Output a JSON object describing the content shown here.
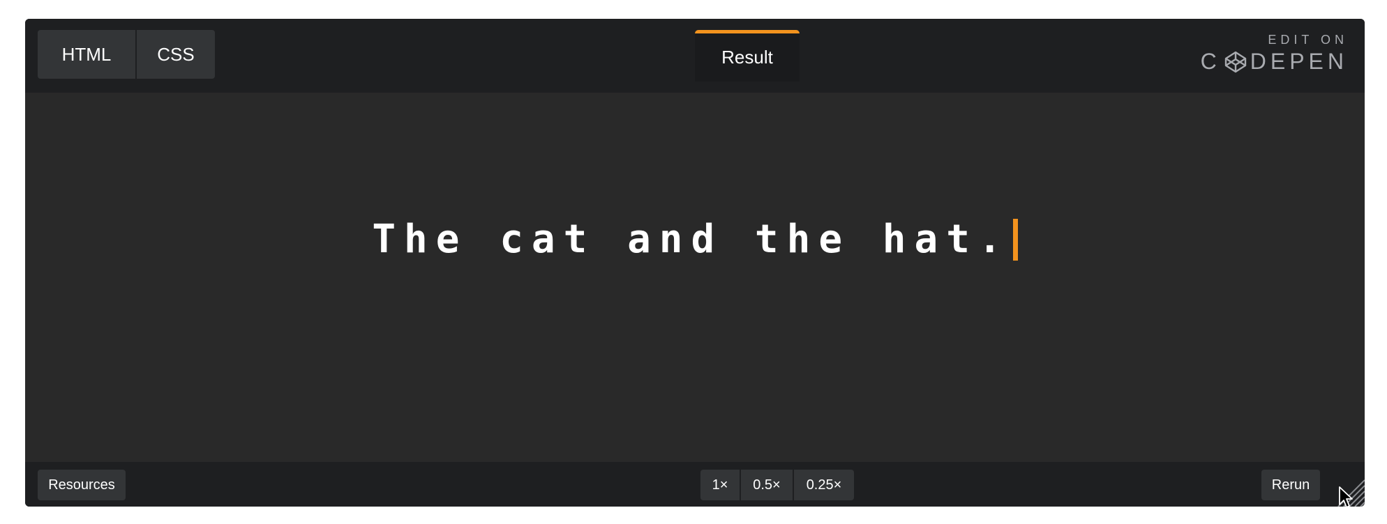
{
  "editor": {
    "tabs": [
      {
        "label": "HTML"
      },
      {
        "label": "CSS"
      }
    ],
    "result_tab": {
      "label": "Result",
      "accent": "#f3931e"
    }
  },
  "brand": {
    "edit_on": "EDIT ON",
    "logo_c": "C",
    "logo_rest": "DEPEN",
    "logo_icon": "codepen-cube-icon"
  },
  "result": {
    "typed_text": "The cat and the hat.",
    "caret_color": "#f3931e"
  },
  "footer": {
    "resources_label": "Resources",
    "zoom_options": [
      "1×",
      "0.5×",
      "0.25×"
    ],
    "rerun_label": "Rerun"
  },
  "icons": {
    "resize": "resize-handle-icon",
    "cursor": "mouse-pointer-icon"
  }
}
